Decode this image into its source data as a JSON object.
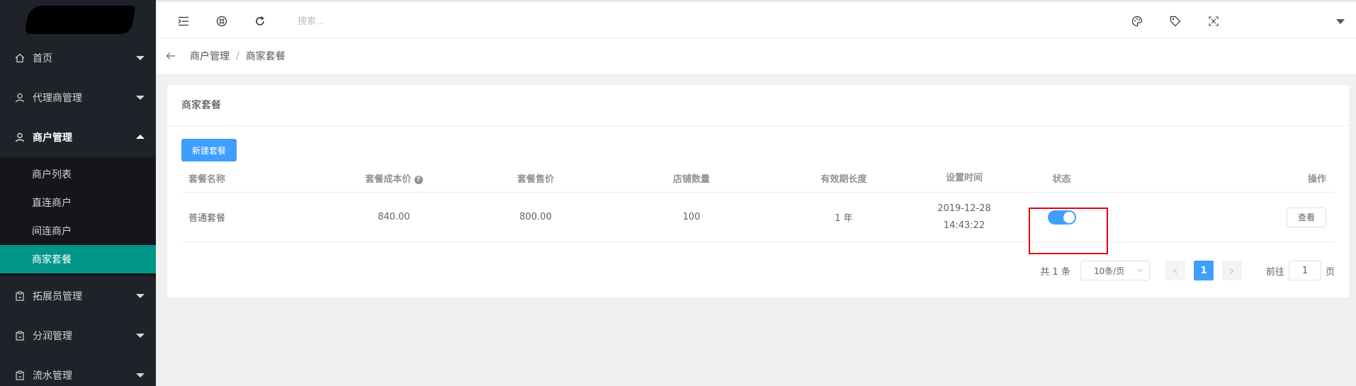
{
  "sidebar": {
    "items": [
      {
        "label": "首页",
        "icon": "home-icon"
      },
      {
        "label": "代理商管理",
        "icon": "user-icon"
      },
      {
        "label": "商户管理",
        "icon": "user-icon",
        "open": true
      },
      {
        "label": "拓展员管理",
        "icon": "clipboard-icon"
      },
      {
        "label": "分润管理",
        "icon": "clipboard-icon"
      },
      {
        "label": "流水管理",
        "icon": "clipboard-icon"
      }
    ],
    "submenu": [
      {
        "label": "商户列表"
      },
      {
        "label": "直连商户"
      },
      {
        "label": "间连商户"
      },
      {
        "label": "商家套餐",
        "active": true
      }
    ]
  },
  "header": {
    "search_placeholder": "搜索..."
  },
  "breadcrumb": {
    "items": [
      "商户管理",
      "商家套餐"
    ],
    "separator": "/"
  },
  "card": {
    "title": "商家套餐",
    "new_button": "新建套餐"
  },
  "table": {
    "columns": [
      "套餐名称",
      "套餐成本价",
      "套餐售价",
      "店铺数量",
      "有效期长度",
      "设置时间",
      "状态",
      "操作"
    ],
    "rows": [
      {
        "name": "普通套餐",
        "cost": "840.00",
        "price": "800.00",
        "stores": "100",
        "validity": "1 年",
        "date": "2019-12-28",
        "time": "14:43:22",
        "status_on": true,
        "action": "查看"
      }
    ]
  },
  "pagination": {
    "total": "共 1 条",
    "page_size": "10条/页",
    "current": "1",
    "goto_prefix": "前往",
    "goto_value": "1",
    "goto_suffix": "页"
  },
  "colors": {
    "sidebar_bg": "#20222a",
    "active_item": "#009688",
    "primary": "#409eff",
    "highlight": "#e60012"
  }
}
